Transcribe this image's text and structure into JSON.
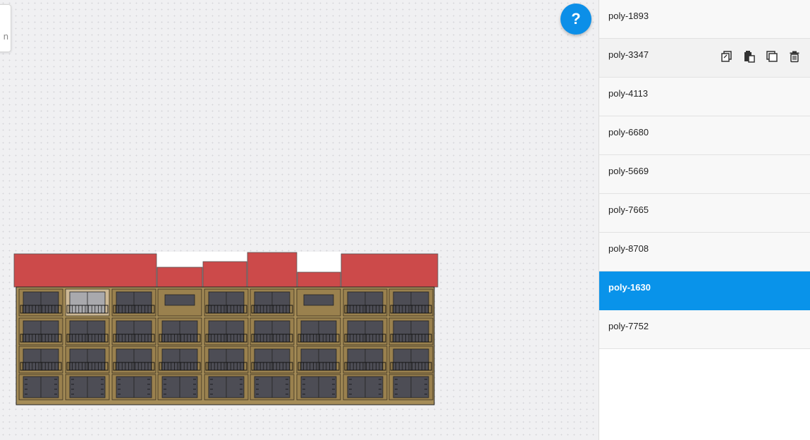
{
  "help": {
    "label": "?"
  },
  "tooltip": {
    "text": "n"
  },
  "polygons": [
    {
      "id": "poly-1893",
      "state": "normal"
    },
    {
      "id": "poly-3347",
      "state": "hovered"
    },
    {
      "id": "poly-4113",
      "state": "normal"
    },
    {
      "id": "poly-6680",
      "state": "normal"
    },
    {
      "id": "poly-5669",
      "state": "normal"
    },
    {
      "id": "poly-7665",
      "state": "normal"
    },
    {
      "id": "poly-8708",
      "state": "normal"
    },
    {
      "id": "poly-1630",
      "state": "selected"
    },
    {
      "id": "poly-7752",
      "state": "normal"
    }
  ],
  "item_actions": [
    "copy-icon",
    "paste-icon",
    "duplicate-icon",
    "trash-icon"
  ],
  "colors": {
    "accent": "#0993ea",
    "roof": "#cc4a4a",
    "facade": "#a68d58",
    "window": "#4d4d55"
  }
}
